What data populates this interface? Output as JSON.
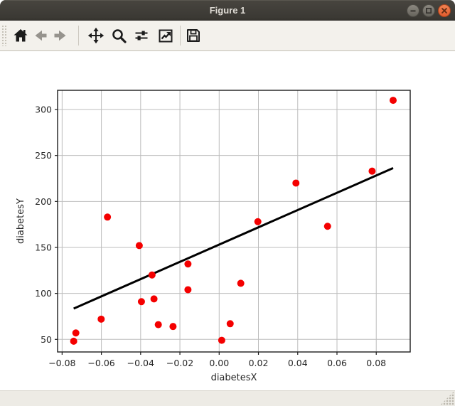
{
  "window": {
    "title": "Figure 1",
    "controls": [
      {
        "name": "minimize",
        "icon": "minimize-icon"
      },
      {
        "name": "maximize",
        "icon": "maximize-icon"
      },
      {
        "name": "close",
        "icon": "close-icon"
      }
    ]
  },
  "toolbar": {
    "buttons": [
      {
        "name": "home",
        "icon": "home-icon"
      },
      {
        "name": "back",
        "icon": "back-arrow-icon",
        "disabled": true
      },
      {
        "name": "forward",
        "icon": "forward-arrow-icon",
        "disabled": true
      },
      {
        "name": "pan",
        "icon": "move-arrows-icon"
      },
      {
        "name": "zoom",
        "icon": "magnifier-icon"
      },
      {
        "name": "configure-subplots",
        "icon": "sliders-icon"
      },
      {
        "name": "edit-axis",
        "icon": "line-chart-icon"
      },
      {
        "name": "save",
        "icon": "floppy-disk-icon"
      }
    ]
  },
  "statusbar": {
    "resize_grip_icon": "resize-grip-icon"
  },
  "colors": {
    "titlebar_bg": "#3b3934",
    "close_button": "#e66434",
    "toolbar_bg": "#f3f1ec",
    "canvas_bg": "#ffffff",
    "marker_red": "#f40000",
    "line_black": "#000000",
    "grid_gray": "#bdbdbd"
  },
  "chart_data": {
    "type": "scatter",
    "title": "",
    "xlabel": "diabetesX",
    "ylabel": "diabetesY",
    "xlim": [
      -0.0823,
      0.0973
    ],
    "ylim": [
      36.3,
      320.9
    ],
    "grid": true,
    "legend": null,
    "xticks": {
      "values": [
        -0.08,
        -0.06,
        -0.04,
        -0.02,
        0.0,
        0.02,
        0.04,
        0.06,
        0.08
      ],
      "labels": [
        "−0.08",
        "−0.06",
        "−0.04",
        "−0.02",
        "0.00",
        "0.02",
        "0.04",
        "0.06",
        "0.08"
      ]
    },
    "yticks": {
      "values": [
        50,
        100,
        150,
        200,
        250,
        300
      ],
      "labels": [
        "50",
        "100",
        "150",
        "200",
        "250",
        "300"
      ]
    },
    "marker_color": "#f40000",
    "marker_radius": 5,
    "grid_color": "#bdbdbd",
    "axis_color": "#1c1c1c",
    "points": [
      {
        "x": 0.0779,
        "y": 233
      },
      {
        "x": -0.0396,
        "y": 91
      },
      {
        "x": 0.011,
        "y": 111
      },
      {
        "x": -0.0407,
        "y": 152
      },
      {
        "x": -0.0342,
        "y": 120
      },
      {
        "x": 0.0056,
        "y": 67
      },
      {
        "x": 0.0886,
        "y": 310
      },
      {
        "x": -0.0332,
        "y": 94
      },
      {
        "x": -0.0569,
        "y": 183
      },
      {
        "x": -0.031,
        "y": 66
      },
      {
        "x": 0.0552,
        "y": 173
      },
      {
        "x": -0.0601,
        "y": 72
      },
      {
        "x": 0.0013,
        "y": 49
      },
      {
        "x": -0.0235,
        "y": 64
      },
      {
        "x": -0.0741,
        "y": 48
      },
      {
        "x": 0.0197,
        "y": 178
      },
      {
        "x": -0.0159,
        "y": 104
      },
      {
        "x": -0.0159,
        "y": 132
      },
      {
        "x": 0.0391,
        "y": 220
      },
      {
        "x": -0.073,
        "y": 57
      }
    ],
    "regression_line": {
      "color": "#000000",
      "width": 3,
      "x": [
        -0.0741,
        0.0886
      ],
      "y": [
        83.5,
        236.3
      ]
    }
  }
}
